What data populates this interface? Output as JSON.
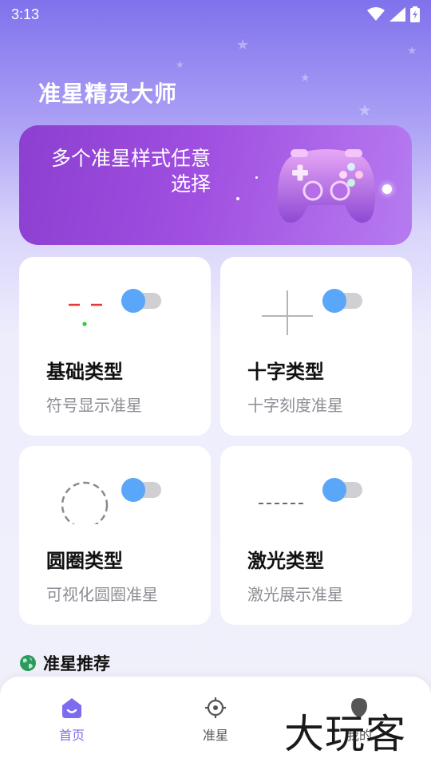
{
  "status_bar": {
    "time": "3:13",
    "icons": [
      "wifi-icon",
      "signal-icon",
      "battery-charging-icon"
    ]
  },
  "app": {
    "title": "准星精灵大师"
  },
  "banner": {
    "text": "多个准星样式任意选择",
    "image": "gamepad-icon"
  },
  "cards": [
    {
      "title": "基础类型",
      "subtitle": "符号显示准星",
      "icon": "basic-crosshair-icon",
      "toggle_on": false
    },
    {
      "title": "十字类型",
      "subtitle": "十字刻度准星",
      "icon": "cross-crosshair-icon",
      "toggle_on": false
    },
    {
      "title": "圆圈类型",
      "subtitle": "可视化圆圈准星",
      "icon": "circle-crosshair-icon",
      "toggle_on": false
    },
    {
      "title": "激光类型",
      "subtitle": "激光展示准星",
      "icon": "laser-crosshair-icon",
      "toggle_on": false
    }
  ],
  "recommend": {
    "title": "准星推荐",
    "icon": "globe-icon"
  },
  "bottom_nav": [
    {
      "label": "首页",
      "icon": "home-icon",
      "active": true
    },
    {
      "label": "准星",
      "icon": "crosshair-icon",
      "active": false
    },
    {
      "label": "我的",
      "icon": "profile-icon",
      "active": false
    }
  ],
  "watermark": "大玩客",
  "colors": {
    "accent": "#7c6cf0",
    "toggle_knob": "#5aa6f9",
    "toggle_track": "#cfcfd4",
    "nav_inactive": "#555555",
    "crosshair_red": "#e53935",
    "crosshair_green": "#2ecc40"
  }
}
